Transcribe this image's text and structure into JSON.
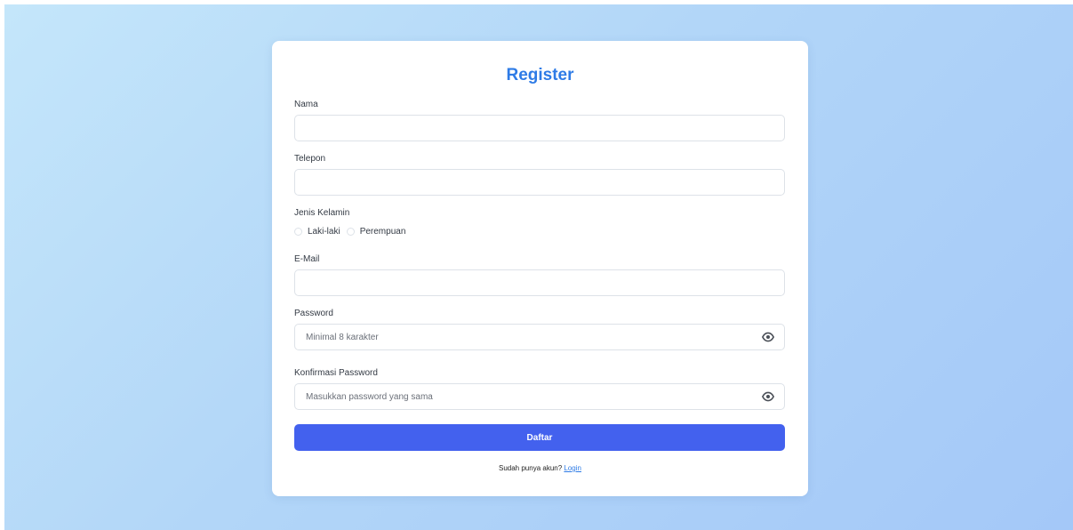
{
  "form": {
    "title": "Register",
    "fields": {
      "nama": {
        "label": "Nama",
        "value": "",
        "placeholder": ""
      },
      "telepon": {
        "label": "Telepon",
        "value": "",
        "placeholder": ""
      },
      "gender": {
        "label": "Jenis Kelamin",
        "options": [
          "Laki-laki",
          "Perempuan"
        ]
      },
      "email": {
        "label": "E-Mail",
        "value": "",
        "placeholder": ""
      },
      "password": {
        "label": "Password",
        "value": "",
        "placeholder": "Minimal 8 karakter"
      },
      "confirm_password": {
        "label": "Konfirmasi Password",
        "value": "",
        "placeholder": "Masukkan password yang sama"
      }
    },
    "submit_label": "Daftar",
    "footer": {
      "text": "Sudah punya akun?",
      "link_label": "Login"
    }
  },
  "colors": {
    "title": "#2e7be6",
    "button": "#4361ee",
    "link": "#2e7be6",
    "background_start": "#c4e6fa",
    "background_end": "#a4c8f8"
  },
  "icons": {
    "password_toggle": "eye-icon",
    "confirm_password_toggle": "eye-icon"
  }
}
